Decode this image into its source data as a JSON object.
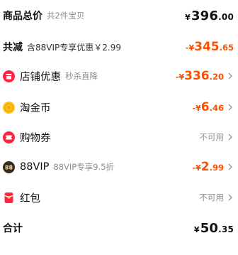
{
  "summary": {
    "goods_total": {
      "label": "商品总价",
      "sub": "共2件宝贝",
      "currency": "¥",
      "int": "396",
      "dec": ".00"
    },
    "total_reduce": {
      "label": "共减",
      "sub": "含88VIP专享优惠￥2.99",
      "prefix": "-¥",
      "int": "345",
      "dec": ".65"
    }
  },
  "discounts": [
    {
      "label": "店铺优惠",
      "sub": "秒杀直降",
      "prefix": "-¥",
      "int": "336",
      "dec": ".20",
      "icon": "shop-icon"
    },
    {
      "label": "淘金币",
      "prefix": "-¥",
      "int": "6",
      "dec": ".46",
      "icon": "gold-coin-icon"
    },
    {
      "label": "购物券",
      "status": "不可用",
      "icon": "coupon-icon"
    },
    {
      "label": "88VIP",
      "sub": "88VIP专享9.5折",
      "prefix": "-¥",
      "int": "2",
      "dec": ".99",
      "icon": "vip88-icon",
      "icon_text": "88"
    },
    {
      "label": "红包",
      "status": "不可用",
      "icon": "red-packet-icon"
    }
  ],
  "grand_total": {
    "label": "合计",
    "currency": "¥",
    "int": "50",
    "dec": ".35"
  },
  "colors": {
    "accent": "#ff5000",
    "icon_red": "#ff2442",
    "coin_gold": "#ffc21a",
    "muted": "#8c8c8c"
  }
}
